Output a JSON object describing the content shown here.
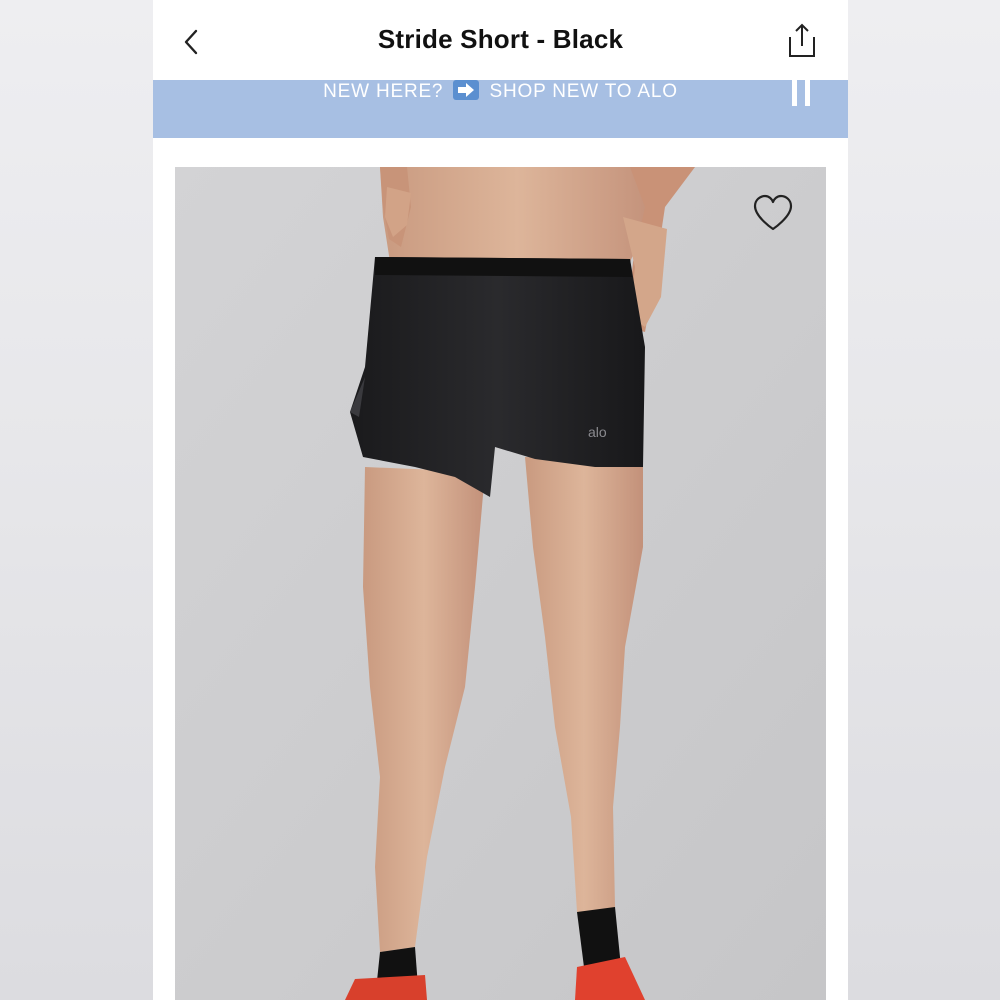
{
  "header": {
    "title": "Stride Short - Black",
    "back_icon": "chevron-left-icon",
    "share_icon": "share-icon"
  },
  "promo_banner": {
    "text_before": "NEW HERE?",
    "text_after": "SHOP NEW TO ALO",
    "arrow_icon": "right-arrow-emoji-icon",
    "pause_icon": "pause-icon",
    "background_color": "#a7bfe3"
  },
  "product": {
    "image_subject": "model wearing black running shorts",
    "brand_mark": "alo",
    "wishlist_icon": "heart-outline-icon"
  }
}
